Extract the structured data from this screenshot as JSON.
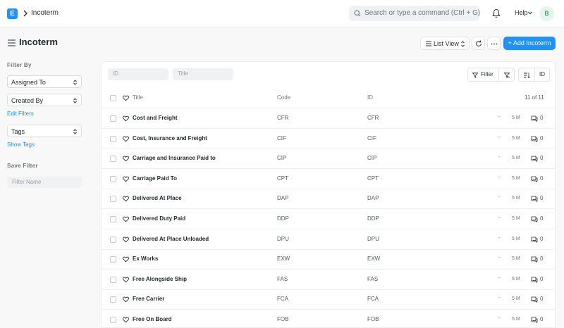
{
  "navbar": {
    "logo": "E",
    "breadcrumb": "Incoterm",
    "search_placeholder": "Search or type a command (Ctrl + G)",
    "help_label": "Help",
    "avatar_initial": "B"
  },
  "page": {
    "title": "Incoterm",
    "list_view_label": "List View",
    "add_button_label": "+ Add Incoterm"
  },
  "sidebar": {
    "filter_by_heading": "Filter By",
    "assigned_to": "Assigned To",
    "created_by": "Created By",
    "edit_filters": "Edit Filters",
    "tags": "Tags",
    "show_tags": "Show Tags",
    "save_filter_heading": "Save Filter",
    "filter_name_placeholder": "Filter Name"
  },
  "filters": {
    "id_placeholder": "ID",
    "title_placeholder": "Title",
    "filter_label": "Filter",
    "sort_label": "ID"
  },
  "table": {
    "headers": {
      "title": "Title",
      "code": "Code",
      "id": "ID"
    },
    "count": "11 of 11",
    "rows": [
      {
        "title": "Cost and Freight",
        "code": "CFR",
        "id": "CFR",
        "dash": "-",
        "time": "5 M",
        "comments": "0"
      },
      {
        "title": "Cost, Insurance and Freight",
        "code": "CIF",
        "id": "CIF",
        "dash": "-",
        "time": "5 M",
        "comments": "0"
      },
      {
        "title": "Carriage and Insurance Paid to",
        "code": "CIP",
        "id": "CIP",
        "dash": "-",
        "time": "5 M",
        "comments": "0"
      },
      {
        "title": "Carriage Paid To",
        "code": "CPT",
        "id": "CPT",
        "dash": "-",
        "time": "5 M",
        "comments": "0"
      },
      {
        "title": "Delivered At Place",
        "code": "DAP",
        "id": "DAP",
        "dash": "-",
        "time": "5 M",
        "comments": "0"
      },
      {
        "title": "Delivered Duty Paid",
        "code": "DDP",
        "id": "DDP",
        "dash": "-",
        "time": "5 M",
        "comments": "0"
      },
      {
        "title": "Delivered At Place Unloaded",
        "code": "DPU",
        "id": "DPU",
        "dash": "-",
        "time": "5 M",
        "comments": "0"
      },
      {
        "title": "Ex Works",
        "code": "EXW",
        "id": "EXW",
        "dash": "-",
        "time": "5 M",
        "comments": "0"
      },
      {
        "title": "Free Alongside Ship",
        "code": "FAS",
        "id": "FAS",
        "dash": "-",
        "time": "5 M",
        "comments": "0"
      },
      {
        "title": "Free Carrier",
        "code": "FCA",
        "id": "FCA",
        "dash": "-",
        "time": "5 M",
        "comments": "0"
      },
      {
        "title": "Free On Board",
        "code": "FOB",
        "id": "FOB",
        "dash": "-",
        "time": "5 M",
        "comments": "0"
      }
    ]
  },
  "colors": {
    "accent": "#2490ef",
    "text": "#1f272e",
    "muted": "#6c7680"
  }
}
